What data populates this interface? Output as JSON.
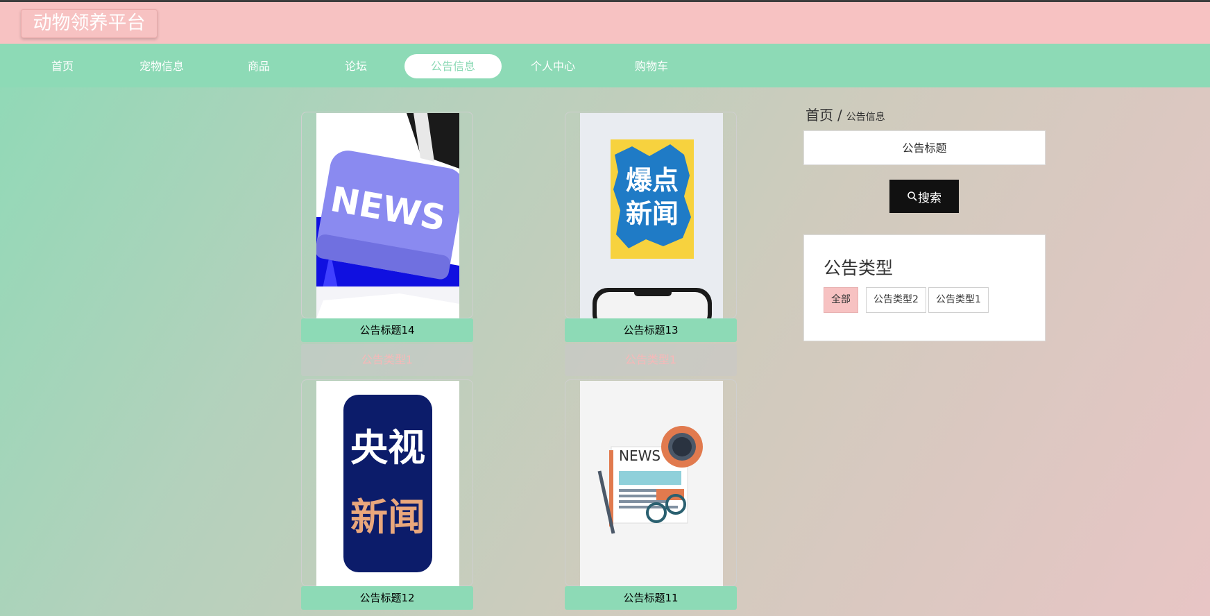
{
  "header": {
    "logo": "动物领养平台"
  },
  "nav": {
    "items": [
      {
        "label": "首页"
      },
      {
        "label": "宠物信息"
      },
      {
        "label": "商品"
      },
      {
        "label": "论坛"
      },
      {
        "label": "公告信息",
        "active": true
      },
      {
        "label": "个人中心"
      },
      {
        "label": "购物车"
      }
    ]
  },
  "cards": [
    {
      "title": "公告标题14",
      "type": "公告类型1",
      "image": "news-keyboard-key"
    },
    {
      "title": "公告标题13",
      "type": "公告类型1",
      "image": "bao-dian-xin-wen-poster",
      "image_text": [
        "爆点",
        "新闻"
      ]
    },
    {
      "title": "公告标题12",
      "image": "cctv-news-logo",
      "image_text": [
        "央视",
        "新闻"
      ]
    },
    {
      "title": "公告标题11",
      "image": "news-illustration",
      "image_text": [
        "NEWS"
      ]
    }
  ],
  "breadcrumb": {
    "home": "首页",
    "separator": "/",
    "current": "公告信息"
  },
  "search": {
    "placeholder": "公告标题",
    "button_label": "搜索",
    "button_icon": "search-icon"
  },
  "type_filter": {
    "heading": "公告类型",
    "options": [
      {
        "label": "全部",
        "active": true
      },
      {
        "label": "公告类型2"
      },
      {
        "label": "公告类型1"
      }
    ]
  },
  "colors": {
    "header_bg": "#f7c2c2",
    "nav_bg": "#8ddab6",
    "search_button": "#111111"
  }
}
